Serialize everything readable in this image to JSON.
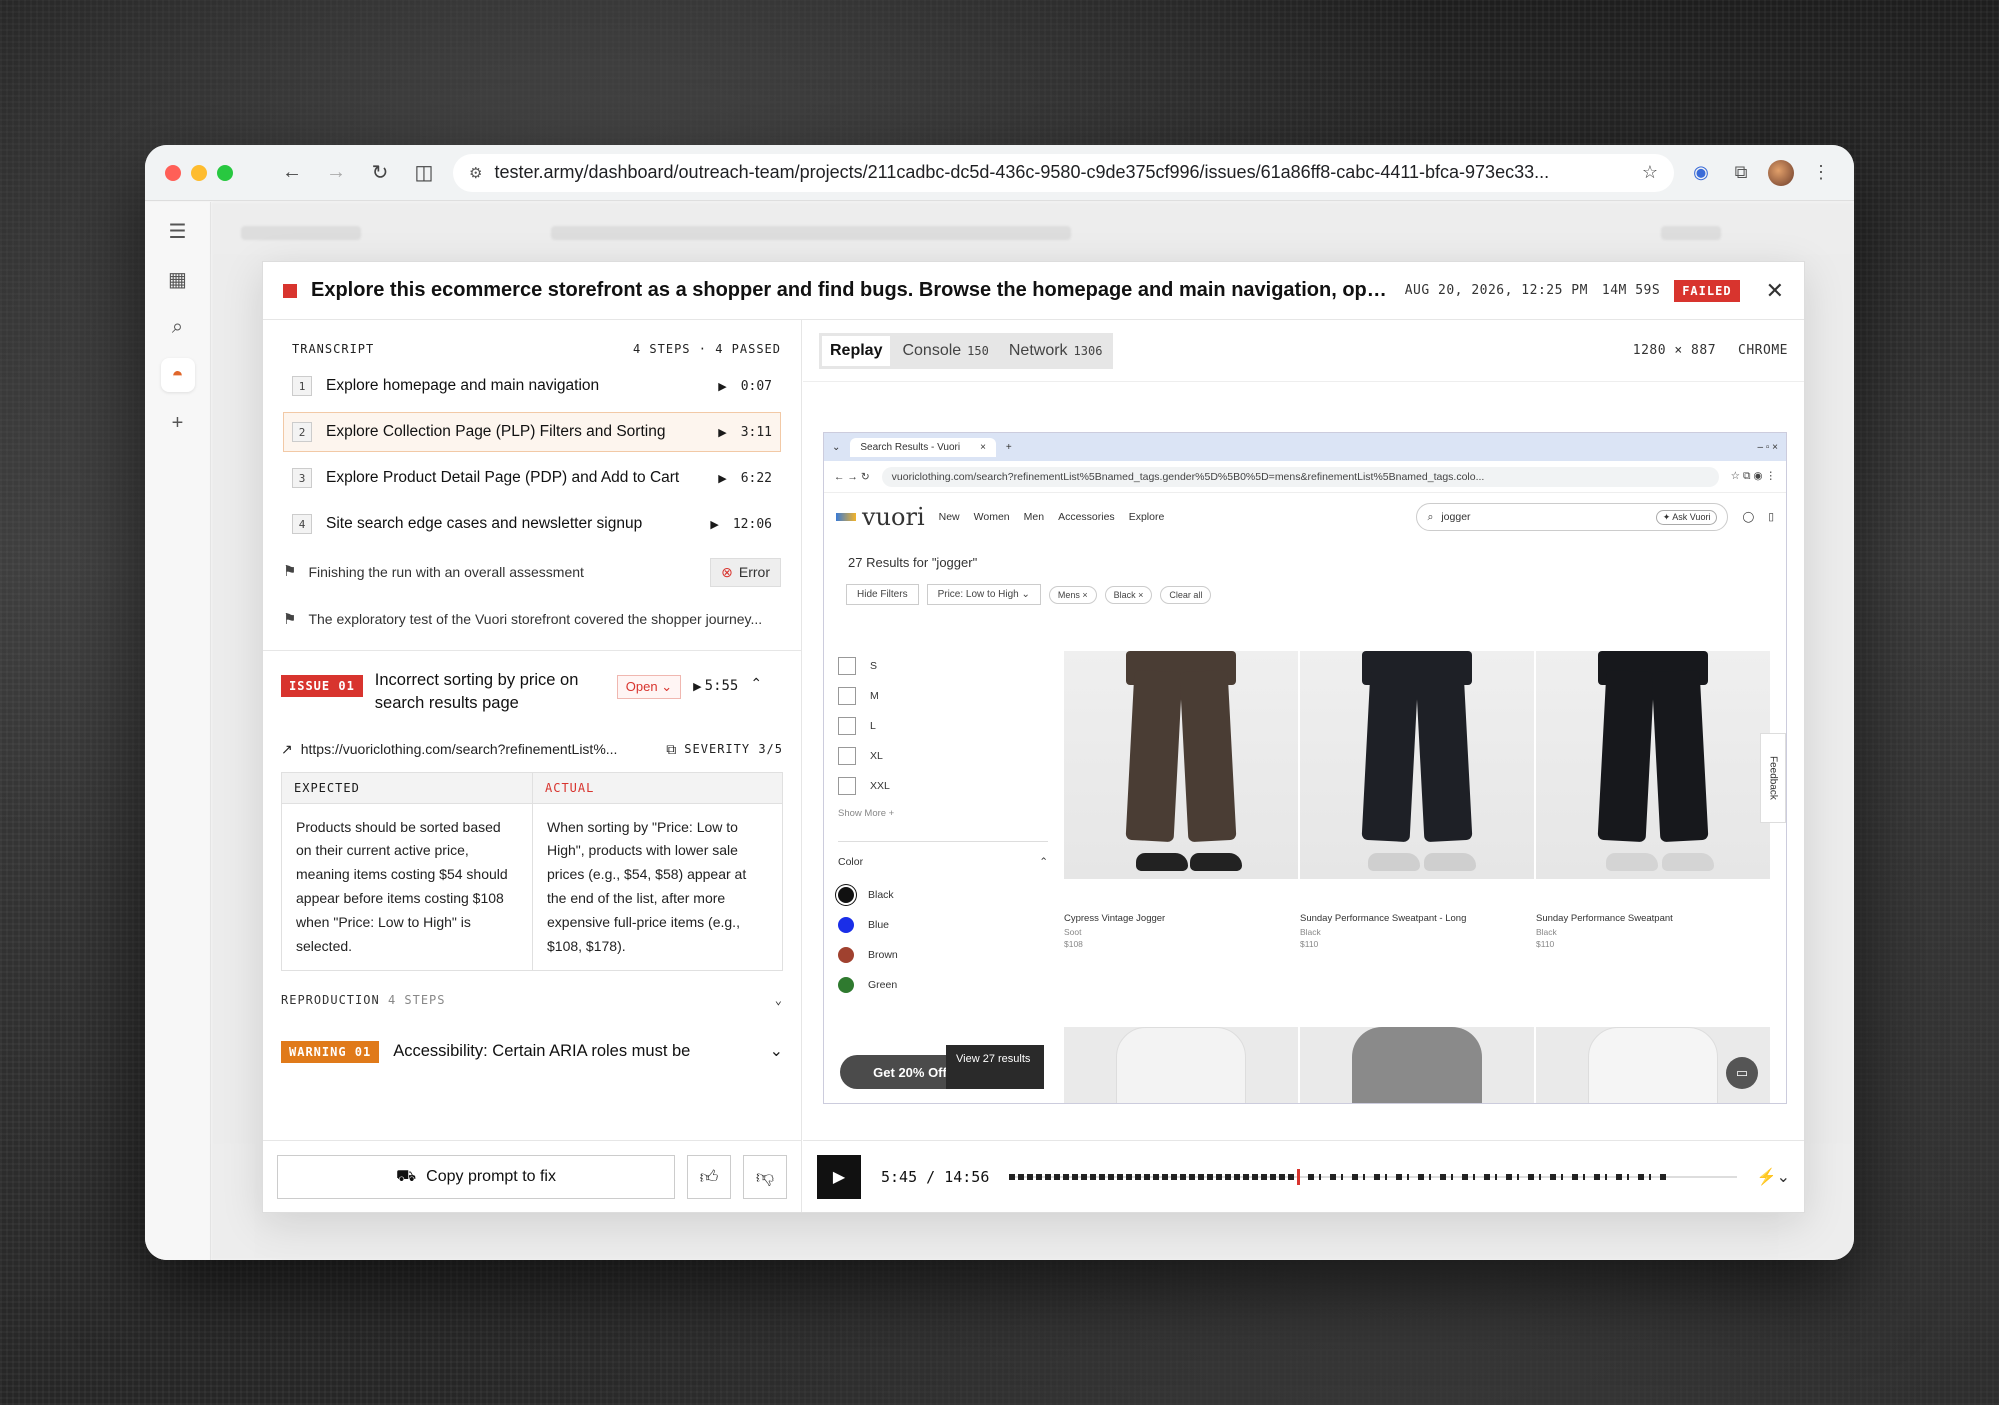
{
  "browser": {
    "url": "tester.army/dashboard/outreach-team/projects/211cadbc-dc5d-436c-9580-c9de375cf996/issues/61a86ff8-cabc-4411-bfca-973ec33..."
  },
  "modal": {
    "title": "Explore this ecommerce storefront as a shopper and find bugs. Browse the homepage and main navigation, open coll...",
    "date": "AUG 20, 2026, 12:25 PM",
    "duration": "14M 59S",
    "status": "FAILED"
  },
  "transcript": {
    "heading": "TRANSCRIPT",
    "summary": "4 STEPS · 4 PASSED",
    "steps": [
      {
        "num": "1",
        "label": "Explore homepage and main navigation",
        "time": "0:07"
      },
      {
        "num": "2",
        "label": "Explore Collection Page (PLP) Filters and Sorting",
        "time": "3:11"
      },
      {
        "num": "3",
        "label": "Explore Product Detail Page (PDP) and Add to Cart",
        "time": "6:22"
      },
      {
        "num": "4",
        "label": "Site search edge cases and newsletter signup",
        "time": "12:06"
      }
    ],
    "note1": "Finishing the run with an overall assessment",
    "error_label": "Error",
    "note2": "The exploratory test of the Vuori storefront covered the shopper journey..."
  },
  "issue": {
    "badge": "ISSUE 01",
    "title": "Incorrect sorting by price on search results page",
    "status": "Open",
    "time": "5:55",
    "url": "https://vuoriclothing.com/search?refinementList%...",
    "severity": "SEVERITY 3/5",
    "expected_label": "EXPECTED",
    "actual_label": "ACTUAL",
    "expected": "Products should be sorted based on their current active price, meaning items costing $54 should appear before items costing $108 when \"Price: Low to High\" is selected.",
    "actual": "When sorting by \"Price: Low to High\", products with lower sale prices (e.g., $54, $58) appear at the end of the list, after more expensive full-price items (e.g., $108, $178).",
    "reproduction": "REPRODUCTION",
    "repro_steps": "4 STEPS"
  },
  "warning": {
    "badge": "WARNING 01",
    "title": "Accessibility: Certain ARIA roles must be contained by particular parents"
  },
  "footer": {
    "copy_label": "Copy prompt to fix"
  },
  "tabs": [
    {
      "label": "Replay",
      "count": ""
    },
    {
      "label": "Console",
      "count": "150"
    },
    {
      "label": "Network",
      "count": "1306"
    }
  ],
  "viewport": {
    "size": "1280 × 887",
    "browser": "CHROME"
  },
  "replay": {
    "tab_title": "Search Results - Vuori",
    "url": "vuoriclothing.com/search?refinementList%5Bnamed_tags.gender%5D%5B0%5D=mens&refinementList%5Bnamed_tags.colo...",
    "logo": "vuori",
    "nav": [
      "New",
      "Women",
      "Men",
      "Accessories",
      "Explore"
    ],
    "search_value": "jogger",
    "ask_label": "✦ Ask Vuori",
    "results_text": "27 Results for \"jogger\"",
    "filters": [
      "Hide Filters",
      "Price: Low to High ⌄"
    ],
    "chips": [
      "Mens ×",
      "Black ×",
      "Clear all"
    ],
    "sizes": [
      "S",
      "M",
      "L",
      "XL",
      "XXL"
    ],
    "show_more": "Show More  +",
    "color_heading": "Color",
    "colors": [
      {
        "name": "Black",
        "hex": "#111111"
      },
      {
        "name": "Blue",
        "hex": "#1a2ee8"
      },
      {
        "name": "Brown",
        "hex": "#a0412f"
      },
      {
        "name": "Green",
        "hex": "#2f7a2f"
      }
    ],
    "products": [
      {
        "name": "Cypress Vintage Jogger",
        "color": "Soot",
        "price": "$108"
      },
      {
        "name": "Sunday Performance Sweatpant - Long",
        "color": "Black",
        "price": "$110"
      },
      {
        "name": "Sunday Performance Sweatpant",
        "color": "Black",
        "price": "$110"
      }
    ],
    "promo": "Get 20% Off",
    "view_results": "View 27 results",
    "feedback": "Feedback"
  },
  "player": {
    "current": "5:45",
    "total": "14:56"
  }
}
